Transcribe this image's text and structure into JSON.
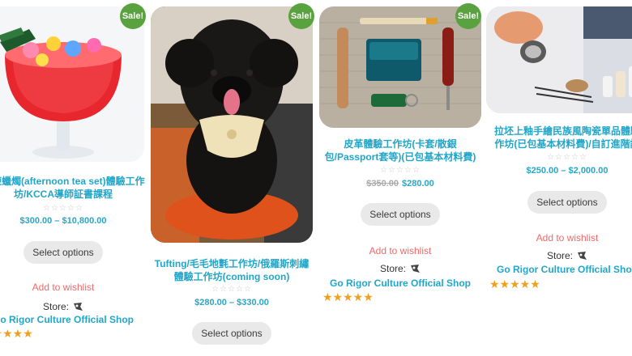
{
  "products": [
    {
      "title_lines": [
        "果凍蠟燭(afternoon tea set)體驗工作",
        "坊/KCCA導師証書課程"
      ],
      "sale_badge": "Sale!",
      "rating_stars": "☆☆☆☆☆",
      "price_range": "$300.00 – $10,800.00",
      "old_price": "",
      "button_label": "Select options",
      "wishlist_label": "Add to wishlist",
      "store_label": "Store:",
      "shop_name": "Go Rigor Culture Official Shop",
      "shop_rating_stars": "★★★★★",
      "image_name": "jelly-candle-image"
    },
    {
      "title_lines": [
        "Tufting/毛毛地氈工作坊/俄羅斯刺繡",
        "體驗工作坊(coming soon)"
      ],
      "sale_badge": "Sale!",
      "rating_stars": "☆☆☆☆☆",
      "price_range": "$280.00 – $330.00",
      "old_price": "",
      "button_label": "Select options",
      "wishlist_label": "",
      "store_label": "",
      "shop_name": "",
      "shop_rating_stars": "",
      "image_name": "poodle-image"
    },
    {
      "title_lines": [
        "皮革體驗工作坊(卡套/散銀",
        "包/Passport套等)(已包基本材料費)"
      ],
      "sale_badge": "Sale!",
      "rating_stars": "☆☆☆☆☆",
      "price_range": "$280.00",
      "old_price": "$350.00",
      "button_label": "Select options",
      "wishlist_label": "Add to wishlist",
      "store_label": "Store:",
      "shop_name": "Go Rigor Culture Official Shop",
      "shop_rating_stars": "★★★★★",
      "image_name": "leather-kit-image"
    },
    {
      "title_lines": [
        "拉坯上釉手繪民族風陶瓷單品體驗",
        "作坊(已包基本材料費)/自訂進階課"
      ],
      "sale_badge": "",
      "rating_stars": "☆☆☆☆☆",
      "price_range": "$250.00 – $2,000.00",
      "old_price": "",
      "button_label": "Select options",
      "wishlist_label": "Add to wishlist",
      "store_label": "Store:",
      "shop_name": "Go Rigor Culture Official Shop",
      "shop_rating_stars": "★★★★★",
      "image_name": "pottery-workshop-image"
    }
  ],
  "colors": {
    "sale_badge": "#5aa13f",
    "title": "#21a6c9",
    "wishlist": "#ee6a6a",
    "stars": "#f0a020",
    "button_bg": "#e9e9e9"
  }
}
